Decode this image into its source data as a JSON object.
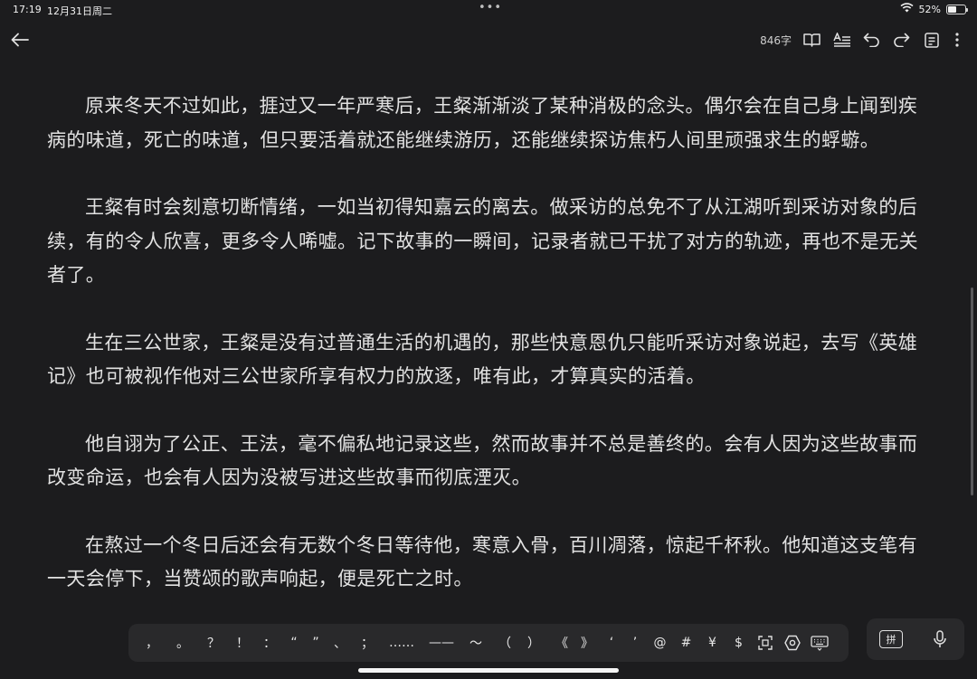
{
  "status": {
    "time": "17:19",
    "date": "12月31日周二",
    "battery": "52%"
  },
  "toolbar": {
    "word_count": "846字"
  },
  "paragraphs": [
    "原来冬天不过如此，捱过又一年严寒后，王粲渐渐淡了某种消极的念头。偶尔会在自己身上闻到疾病的味道，死亡的味道，但只要活着就还能继续游历，还能继续探访焦朽人间里顽强求生的蜉蝣。",
    "王粲有时会刻意切断情绪，一如当初得知嘉云的离去。做采访的总免不了从江湖听到采访对象的后续，有的令人欣喜，更多令人唏嘘。记下故事的一瞬间，记录者就已干扰了对方的轨迹，再也不是无关者了。",
    "生在三公世家，王粲是没有过普通生活的机遇的，那些快意恩仇只能听采访对象说起，去写《英雄记》也可被视作他对三公世家所享有权力的放逐，唯有此，才算真实的活着。",
    "他自诩为了公正、王法，毫不偏私地记录这些，然而故事并不总是善终的。会有人因为这些故事而改变命运，也会有人因为没被写进这些故事而彻底湮灭。",
    "在熬过一个冬日后还会有无数个冬日等待他，寒意入骨，百川凋落，惊起千杯秋。他知道这支笔有一天会停下，当赞颂的歌声响起，便是死亡之时。"
  ],
  "keyboard": {
    "keys": [
      "，",
      "。",
      "？",
      "！",
      "：",
      "“",
      "”",
      "、",
      "；",
      "……",
      "——",
      "～",
      "（",
      "）",
      "《",
      "》",
      "‘",
      "’",
      "@",
      "#",
      "¥",
      "$"
    ],
    "ime_label": "拼"
  }
}
